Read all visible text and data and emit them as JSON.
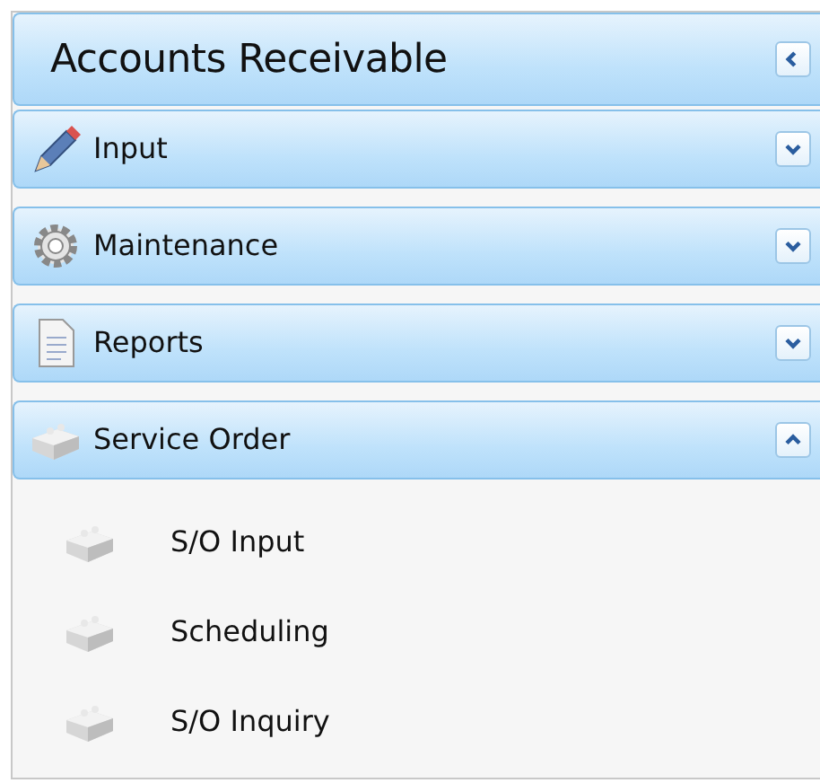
{
  "title": "Accounts Receivable",
  "sections": [
    {
      "label": "Input",
      "kind": "pencil",
      "expanded": false
    },
    {
      "label": "Maintenance",
      "kind": "gear",
      "expanded": false
    },
    {
      "label": "Reports",
      "kind": "document",
      "expanded": false
    },
    {
      "label": "Service Order",
      "kind": "brick",
      "expanded": true,
      "items": [
        {
          "label": "S/O Input"
        },
        {
          "label": "Scheduling"
        },
        {
          "label": "S/O Inquiry"
        }
      ]
    }
  ]
}
